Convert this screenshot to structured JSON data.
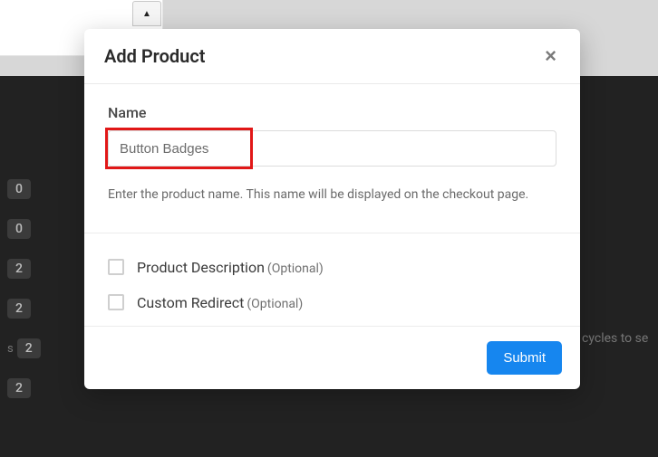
{
  "modal": {
    "title": "Add Product",
    "close_icon": "×",
    "name": {
      "label": "Name",
      "value": "Button Badges",
      "help": "Enter the product name. This name will be displayed on the checkout page."
    },
    "options": {
      "description": {
        "label": "Product Description",
        "suffix": "(Optional)",
        "checked": false
      },
      "redirect": {
        "label": "Custom Redirect",
        "suffix": "(Optional)",
        "checked": false
      }
    },
    "submit_label": "Submit"
  },
  "background": {
    "stepper_icon": "▲",
    "badges": [
      {
        "prefix": "",
        "count": "0"
      },
      {
        "prefix": "",
        "count": "0"
      },
      {
        "prefix": "",
        "count": "2"
      },
      {
        "prefix": "",
        "count": "2"
      },
      {
        "prefix": "s",
        "count": "2"
      },
      {
        "prefix": "",
        "count": "2"
      }
    ],
    "trailing_text": "cycles to se"
  }
}
